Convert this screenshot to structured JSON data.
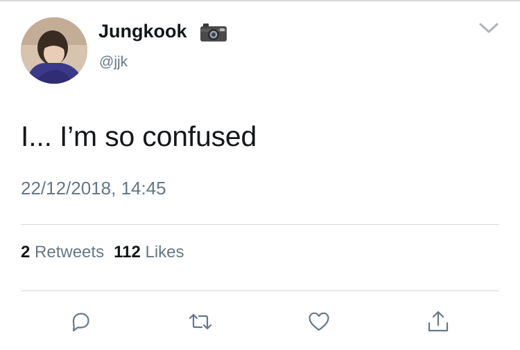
{
  "tweet": {
    "author": {
      "display_name": "Jungkook",
      "handle": "@jjk",
      "name_badge_icon": "camera-icon"
    },
    "text": "I... I’m so confused",
    "timestamp": "22/12/2018, 14:45",
    "stats": {
      "retweets_count": "2",
      "retweets_label": "Retweets",
      "likes_count": "112",
      "likes_label": "Likes"
    },
    "actions": [
      "reply-icon",
      "retweet-icon",
      "like-icon",
      "share-icon"
    ],
    "more_menu_icon": "chevron-down-icon"
  },
  "colors": {
    "text_primary": "#14171a",
    "text_secondary": "#657786",
    "divider": "#d3d6da",
    "icon": "#657786"
  }
}
